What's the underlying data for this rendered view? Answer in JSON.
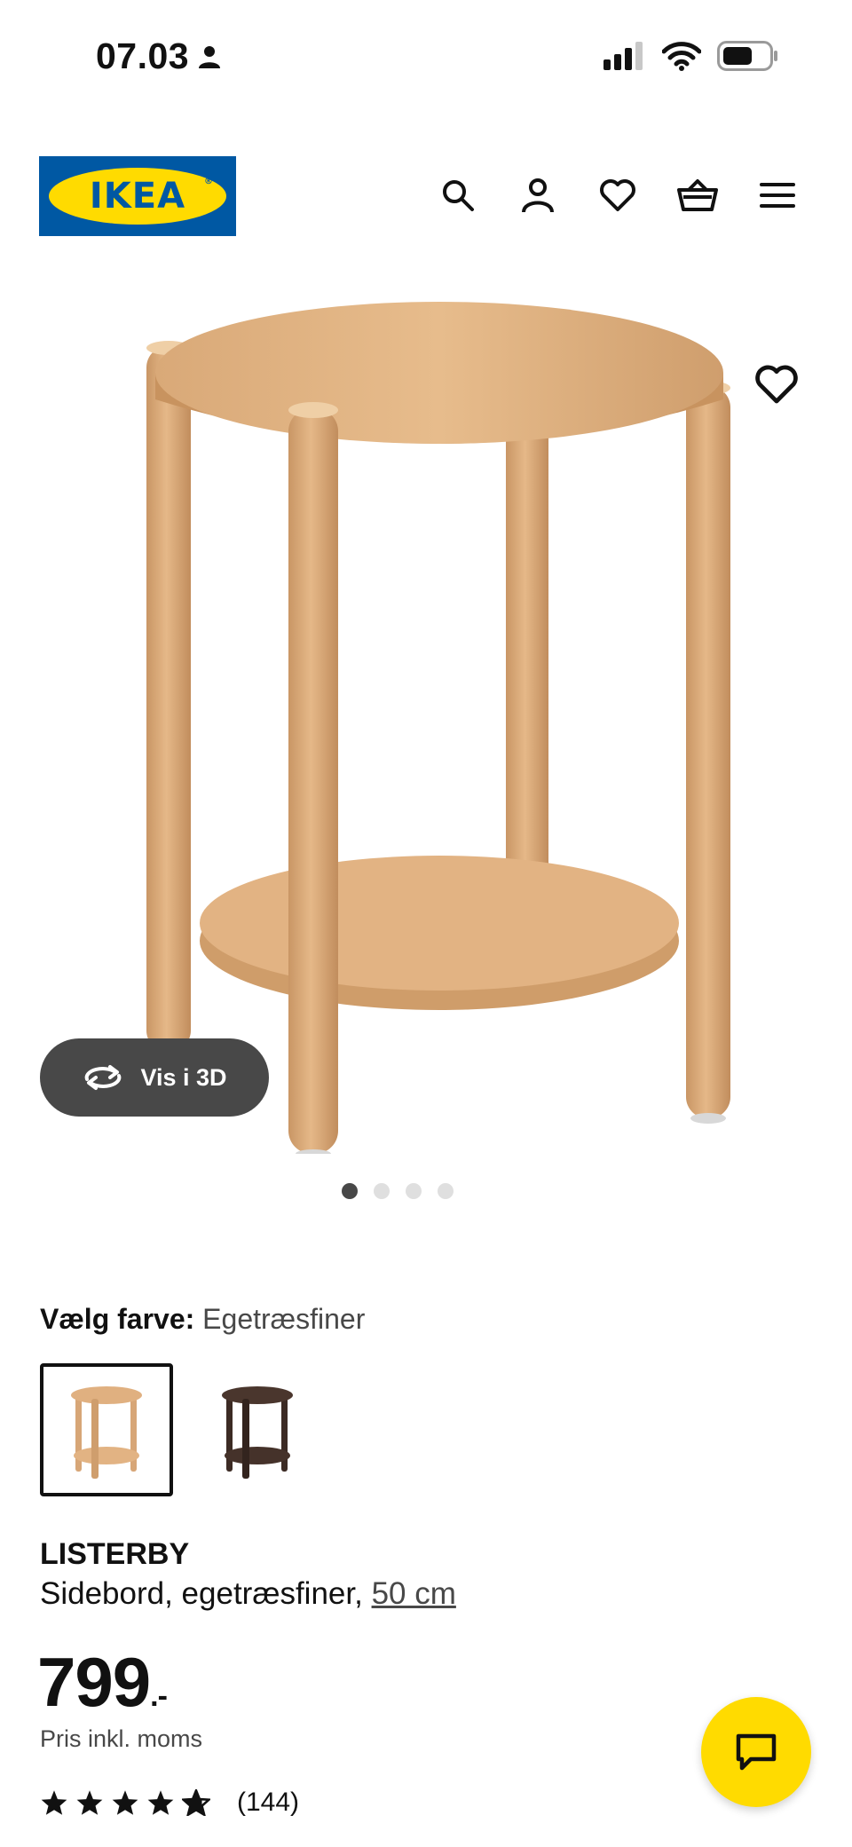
{
  "status_bar": {
    "time": "07.03"
  },
  "header": {
    "logo_text": "IKEA",
    "icons": [
      "search-icon",
      "user-icon",
      "heart-icon",
      "basket-icon",
      "menu-icon"
    ]
  },
  "gallery": {
    "view_3d_label": "Vis i 3D",
    "dot_count": 4,
    "active_dot": 1
  },
  "color_select": {
    "label": "Vælg farve:",
    "value": "Egetræsfiner",
    "options": [
      "Egetræsfiner",
      "Mørkebrun"
    ]
  },
  "product": {
    "name": "LISTERBY",
    "description": "Sidebord, egetræsfiner,",
    "size_link": "50 cm",
    "price": "799",
    "price_suffix": ".-",
    "price_note": "Pris inkl. moms",
    "rating_count": "(144)",
    "rating_stars": 4.5
  },
  "colors": {
    "ikea_blue": "#0058a3",
    "ikea_yellow": "#ffdb00",
    "dark_button": "#484848"
  }
}
